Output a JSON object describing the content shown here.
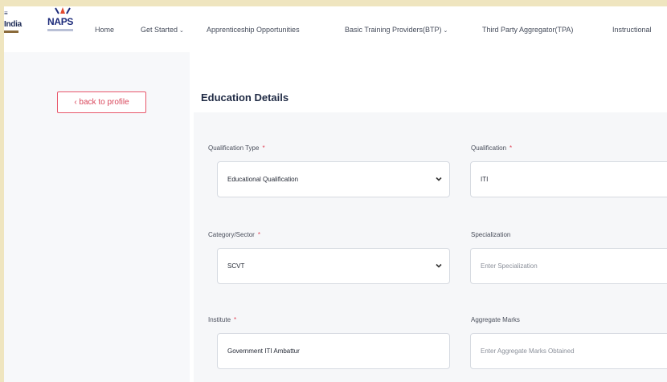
{
  "header": {
    "logo_india": "India",
    "logo_naps": "NAPS",
    "nav": [
      {
        "label": "Home",
        "dropdown": false
      },
      {
        "label": "Get Started",
        "dropdown": true
      },
      {
        "label": "Apprenticeship Opportunities",
        "dropdown": false
      },
      {
        "label": "Basic Training Providers(BTP)",
        "dropdown": true
      },
      {
        "label": "Third Party Aggregator(TPA)",
        "dropdown": false
      },
      {
        "label": "Instructional",
        "dropdown": false
      }
    ]
  },
  "sidebar": {
    "back_button": "‹ back to profile"
  },
  "main": {
    "title": "Education Details",
    "form": {
      "qualification_type": {
        "label": "Qualification Type",
        "value": "Educational Qualification",
        "required": "*"
      },
      "qualification": {
        "label": "Qualification",
        "value": "ITI",
        "required": "*"
      },
      "category_sector": {
        "label": "Category/Sector",
        "value": "SCVT",
        "required": "*"
      },
      "specialization": {
        "label": "Specialization",
        "placeholder": "Enter Specialization"
      },
      "institute": {
        "label": "Institute",
        "value": "Government ITI Ambattur",
        "required": "*"
      },
      "aggregate_marks": {
        "label": "Aggregate Marks",
        "placeholder": "Enter Aggregate Marks Obtained"
      }
    }
  },
  "colors": {
    "accent": "#e8566a",
    "naps_blue": "#1c2a7a",
    "title": "#1f2a44"
  }
}
